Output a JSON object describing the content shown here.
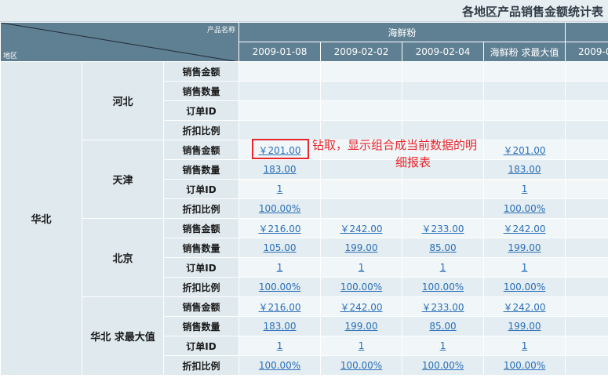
{
  "report": {
    "title": "各地区产品销售金额统计表"
  },
  "header": {
    "corner_top": "产品名称",
    "corner_bottom": "地区",
    "product": "海鲜粉",
    "columns": [
      "2009-01-08",
      "2009-02-02",
      "2009-02-04",
      "海鲜粉 求最大值",
      "2009-0"
    ]
  },
  "region": "华北",
  "provinces": [
    {
      "name": "河北",
      "rows": [
        {
          "metric": "销售金额",
          "values": [
            "",
            "",
            "",
            "",
            ""
          ]
        },
        {
          "metric": "销售数量",
          "values": [
            "",
            "",
            "",
            "",
            ""
          ]
        },
        {
          "metric": "订单ID",
          "values": [
            "",
            "",
            "",
            "",
            ""
          ]
        },
        {
          "metric": "折扣比例",
          "values": [
            "",
            "",
            "",
            "",
            ""
          ]
        }
      ]
    },
    {
      "name": "天津",
      "rows": [
        {
          "metric": "销售金额",
          "values": [
            "￥201.00",
            "",
            "",
            "￥201.00",
            ""
          ]
        },
        {
          "metric": "销售数量",
          "values": [
            "183.00",
            "",
            "",
            "183.00",
            ""
          ]
        },
        {
          "metric": "订单ID",
          "values": [
            "1",
            "",
            "",
            "1",
            ""
          ]
        },
        {
          "metric": "折扣比例",
          "values": [
            "100.00%",
            "",
            "",
            "100.00%",
            ""
          ]
        }
      ]
    },
    {
      "name": "北京",
      "rows": [
        {
          "metric": "销售金额",
          "values": [
            "￥216.00",
            "￥242.00",
            "￥233.00",
            "￥242.00",
            ""
          ]
        },
        {
          "metric": "销售数量",
          "values": [
            "105.00",
            "199.00",
            "85.00",
            "199.00",
            ""
          ]
        },
        {
          "metric": "订单ID",
          "values": [
            "1",
            "1",
            "1",
            "1",
            ""
          ]
        },
        {
          "metric": "折扣比例",
          "values": [
            "100.00%",
            "100.00%",
            "100.00%",
            "100.00%",
            ""
          ]
        }
      ]
    },
    {
      "name": "华北 求最大值",
      "rows": [
        {
          "metric": "销售金额",
          "values": [
            "￥216.00",
            "￥242.00",
            "￥233.00",
            "￥242.00",
            ""
          ]
        },
        {
          "metric": "销售数量",
          "values": [
            "183.00",
            "199.00",
            "85.00",
            "199.00",
            ""
          ]
        },
        {
          "metric": "订单ID",
          "values": [
            "1",
            "1",
            "1",
            "1",
            ""
          ]
        },
        {
          "metric": "折扣比例",
          "values": [
            "100.00%",
            "100.00%",
            "100.00%",
            "100.00%",
            ""
          ]
        }
      ]
    }
  ],
  "annotation": {
    "line1": "钻取，显示组合成当前数据的明",
    "line2": "细报表"
  },
  "colors": {
    "header_bg": "#5f7f92",
    "label_bg": "#dfe9ee",
    "row_light": "#f1f6f8",
    "row_dark": "#e4edf1",
    "link": "#2a6fb8",
    "annotation": "#e8262d"
  }
}
